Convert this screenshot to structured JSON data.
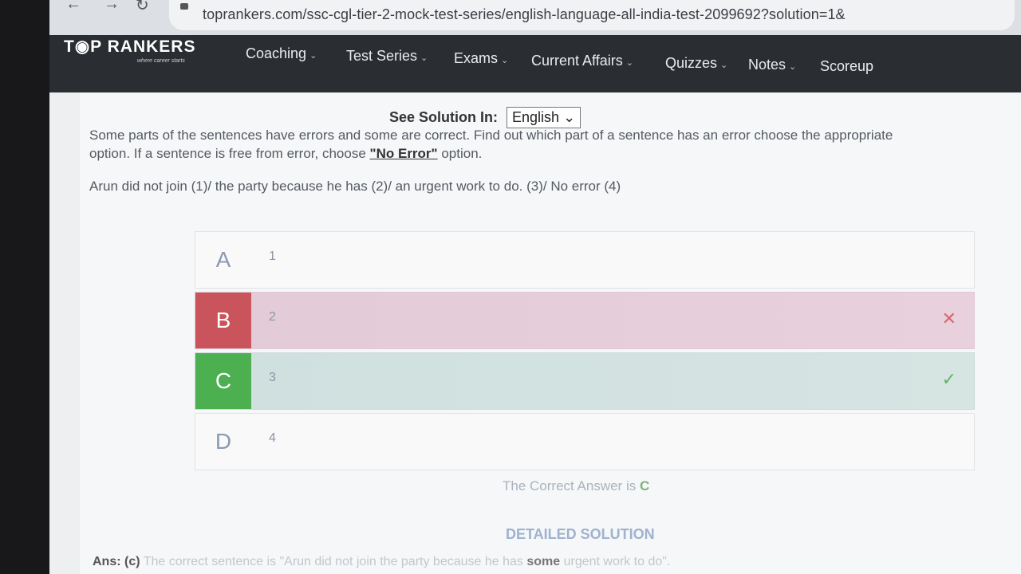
{
  "browser": {
    "url": "toprankers.com/ssc-cgl-tier-2-mock-test-series/english-language-all-india-test-2099692?solution=1&"
  },
  "header": {
    "logo_text": "T◉P RANKERS",
    "logo_tagline": "where career starts",
    "menu": [
      "Coaching",
      "Test Series",
      "Exams",
      "Current Affairs",
      "Quizzes",
      "Notes",
      "Scoreup"
    ]
  },
  "solution": {
    "label": "See Solution In:",
    "language": "English"
  },
  "question": {
    "instructions_part1": "Some parts of the sentences have errors and some are correct. Find out which part of a sentence has an error choose the appropriate",
    "instructions_part2": "option. If a sentence is free from error, choose",
    "no_error": "\"No Error\"",
    "instructions_part3": "option.",
    "sentence": "Arun did not join (1)/ the party because he has (2)/ an urgent work to do. (3)/ No error (4)"
  },
  "options": [
    {
      "letter": "A",
      "text": "1",
      "state": "neutral"
    },
    {
      "letter": "B",
      "text": "2",
      "state": "wrong"
    },
    {
      "letter": "C",
      "text": "3",
      "state": "correct"
    },
    {
      "letter": "D",
      "text": "4",
      "state": "neutral"
    }
  ],
  "answer": {
    "correct_label": "The Correct Answer is",
    "correct_letter": "C",
    "detailed_heading": "DETAILED SOLUTION",
    "ans_prefix": "Ans: (c)",
    "ans_text1": "The correct sentence is \"Arun did not join the party because he has",
    "ans_bold": "some",
    "ans_text2": "urgent work to do\"."
  }
}
